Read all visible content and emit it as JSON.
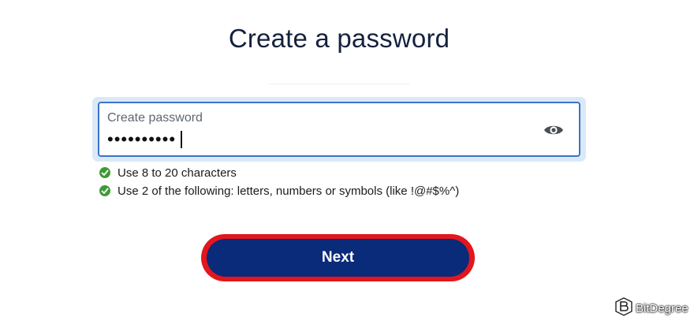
{
  "page": {
    "title": "Create a password"
  },
  "password_field": {
    "label": "Create password",
    "value_masked": "••••••••••",
    "visibility_toggle_icon": "eye-icon"
  },
  "requirements": [
    {
      "text": "Use 8 to 20 characters",
      "met": true,
      "icon": "check-circle-icon"
    },
    {
      "text": "Use 2 of the following: letters, numbers or symbols (like !@#$%^)",
      "met": true,
      "icon": "check-circle-icon"
    }
  ],
  "actions": {
    "next_label": "Next"
  },
  "watermark": {
    "text": "BitDegree"
  },
  "colors": {
    "title": "#14213d",
    "field_border": "#3a74c9",
    "field_focus_ring": "#dbe9f7",
    "check": "#3f9a36",
    "button": "#0a2a7a",
    "button_highlight": "#e2161d"
  }
}
